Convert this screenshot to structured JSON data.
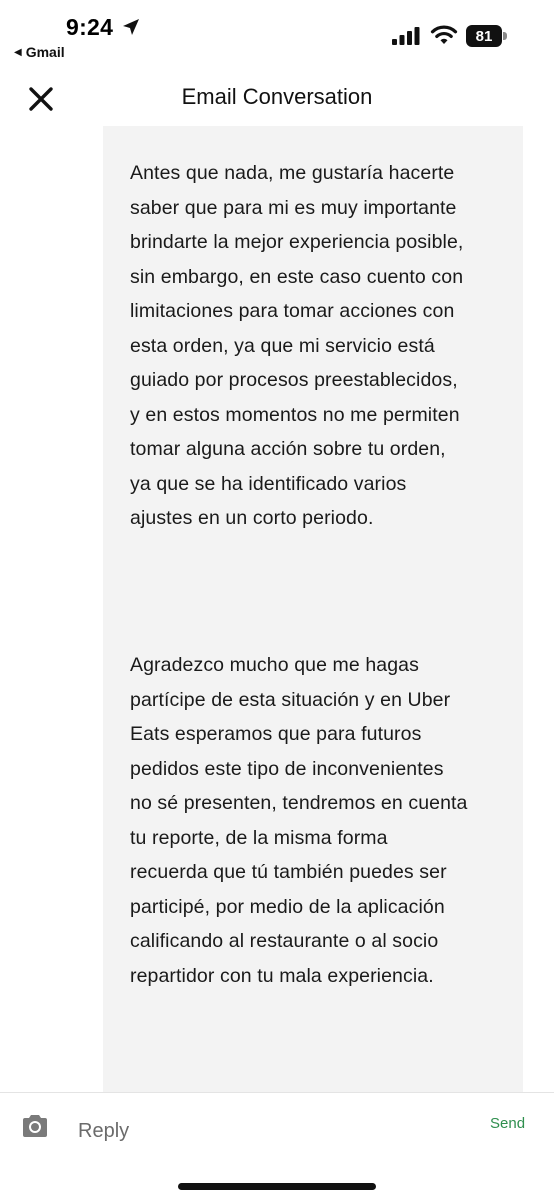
{
  "status_bar": {
    "time": "9:24",
    "back_app": "Gmail",
    "battery": "81"
  },
  "header": {
    "title": "Email Conversation"
  },
  "message": {
    "paragraph_1_lines": [
      "Antes que nada, me gustaría hacerte",
      "saber que para mi es muy importante",
      "brindarte la mejor experiencia posible,",
      "sin embargo, en este caso cuento con",
      "limitaciones para tomar acciones con",
      "esta orden, ya que mi servicio está",
      "guiado por procesos preestablecidos,",
      "y en estos momentos no me permiten",
      "tomar alguna acción sobre tu orden,",
      "ya que se ha identificado varios",
      "ajustes en un corto periodo."
    ],
    "paragraph_2_lines": [
      "Agradezco mucho que me hagas",
      "partícipe de esta situación y en Uber",
      "Eats esperamos que para futuros",
      "pedidos este tipo de inconvenientes",
      "no sé presenten, tendremos en cuenta",
      "tu reporte, de la misma forma",
      "recuerda que tú también puedes ser",
      "participé, por medio de la aplicación",
      "calificando al restaurante o al socio",
      "repartidor con tu mala experiencia."
    ]
  },
  "composer": {
    "reply_placeholder": "Reply",
    "reply_value": "",
    "send_label": "Send"
  },
  "colors": {
    "send": "#2f8f4e",
    "panel_bg": "#f3f3f3"
  },
  "icons": {
    "location": "location-arrow-icon",
    "signal": "cellular-signal-icon",
    "wifi": "wifi-icon",
    "close": "close-icon",
    "camera": "camera-icon"
  }
}
